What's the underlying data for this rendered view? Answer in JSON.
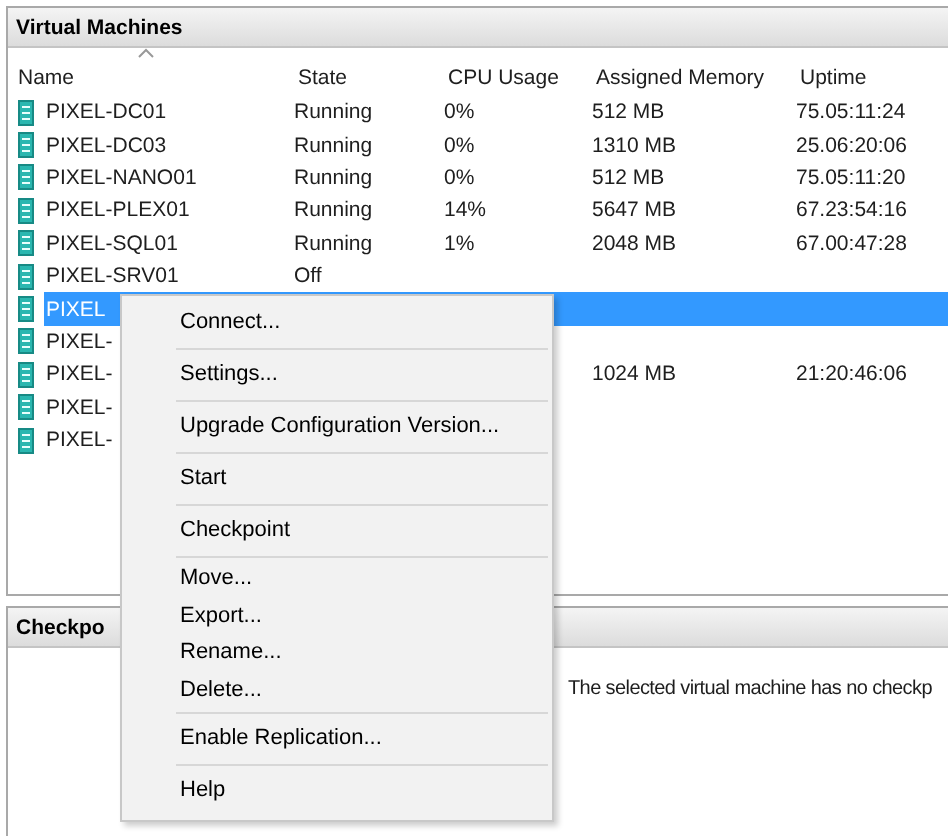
{
  "vm_panel": {
    "title": "Virtual Machines",
    "columns": [
      {
        "label": "Name",
        "sorted": true
      },
      {
        "label": "State",
        "sorted": false
      },
      {
        "label": "CPU Usage",
        "sorted": false
      },
      {
        "label": "Assigned Memory",
        "sorted": false
      },
      {
        "label": "Uptime",
        "sorted": false
      }
    ],
    "rows": [
      {
        "name": "PIXEL-DC01",
        "state": "Running",
        "cpu": "0%",
        "memory": "512 MB",
        "uptime": "75.05:11:24",
        "selected": false
      },
      {
        "name": "PIXEL-DC03",
        "state": "Running",
        "cpu": "0%",
        "memory": "1310 MB",
        "uptime": "25.06:20:06",
        "selected": false
      },
      {
        "name": "PIXEL-NANO01",
        "state": "Running",
        "cpu": "0%",
        "memory": "512 MB",
        "uptime": "75.05:11:20",
        "selected": false
      },
      {
        "name": "PIXEL-PLEX01",
        "state": "Running",
        "cpu": "14%",
        "memory": "5647 MB",
        "uptime": "67.23:54:16",
        "selected": false
      },
      {
        "name": "PIXEL-SQL01",
        "state": "Running",
        "cpu": "1%",
        "memory": "2048 MB",
        "uptime": "67.00:47:28",
        "selected": false
      },
      {
        "name": "PIXEL-SRV01",
        "state": "Off",
        "selected": false
      },
      {
        "name": "PIXEL",
        "selected": true
      },
      {
        "name": "PIXEL-",
        "selected": false
      },
      {
        "name": "PIXEL-",
        "memory": "1024 MB",
        "uptime": "21:20:46:06",
        "selected": false
      },
      {
        "name": "PIXEL-",
        "selected": false
      },
      {
        "name": "PIXEL-",
        "selected": false
      }
    ]
  },
  "checkpoints_panel": {
    "title": "Checkpo",
    "message": "The selected virtual machine has no checkp"
  },
  "context_menu": {
    "groups": [
      [
        "Connect..."
      ],
      [
        "Settings..."
      ],
      [
        "Upgrade Configuration Version..."
      ],
      [
        "Start"
      ],
      [
        "Checkpoint"
      ],
      [
        "Move...",
        "Export...",
        "Rename...",
        "Delete..."
      ],
      [
        "Enable Replication..."
      ],
      [
        "Help"
      ]
    ]
  }
}
